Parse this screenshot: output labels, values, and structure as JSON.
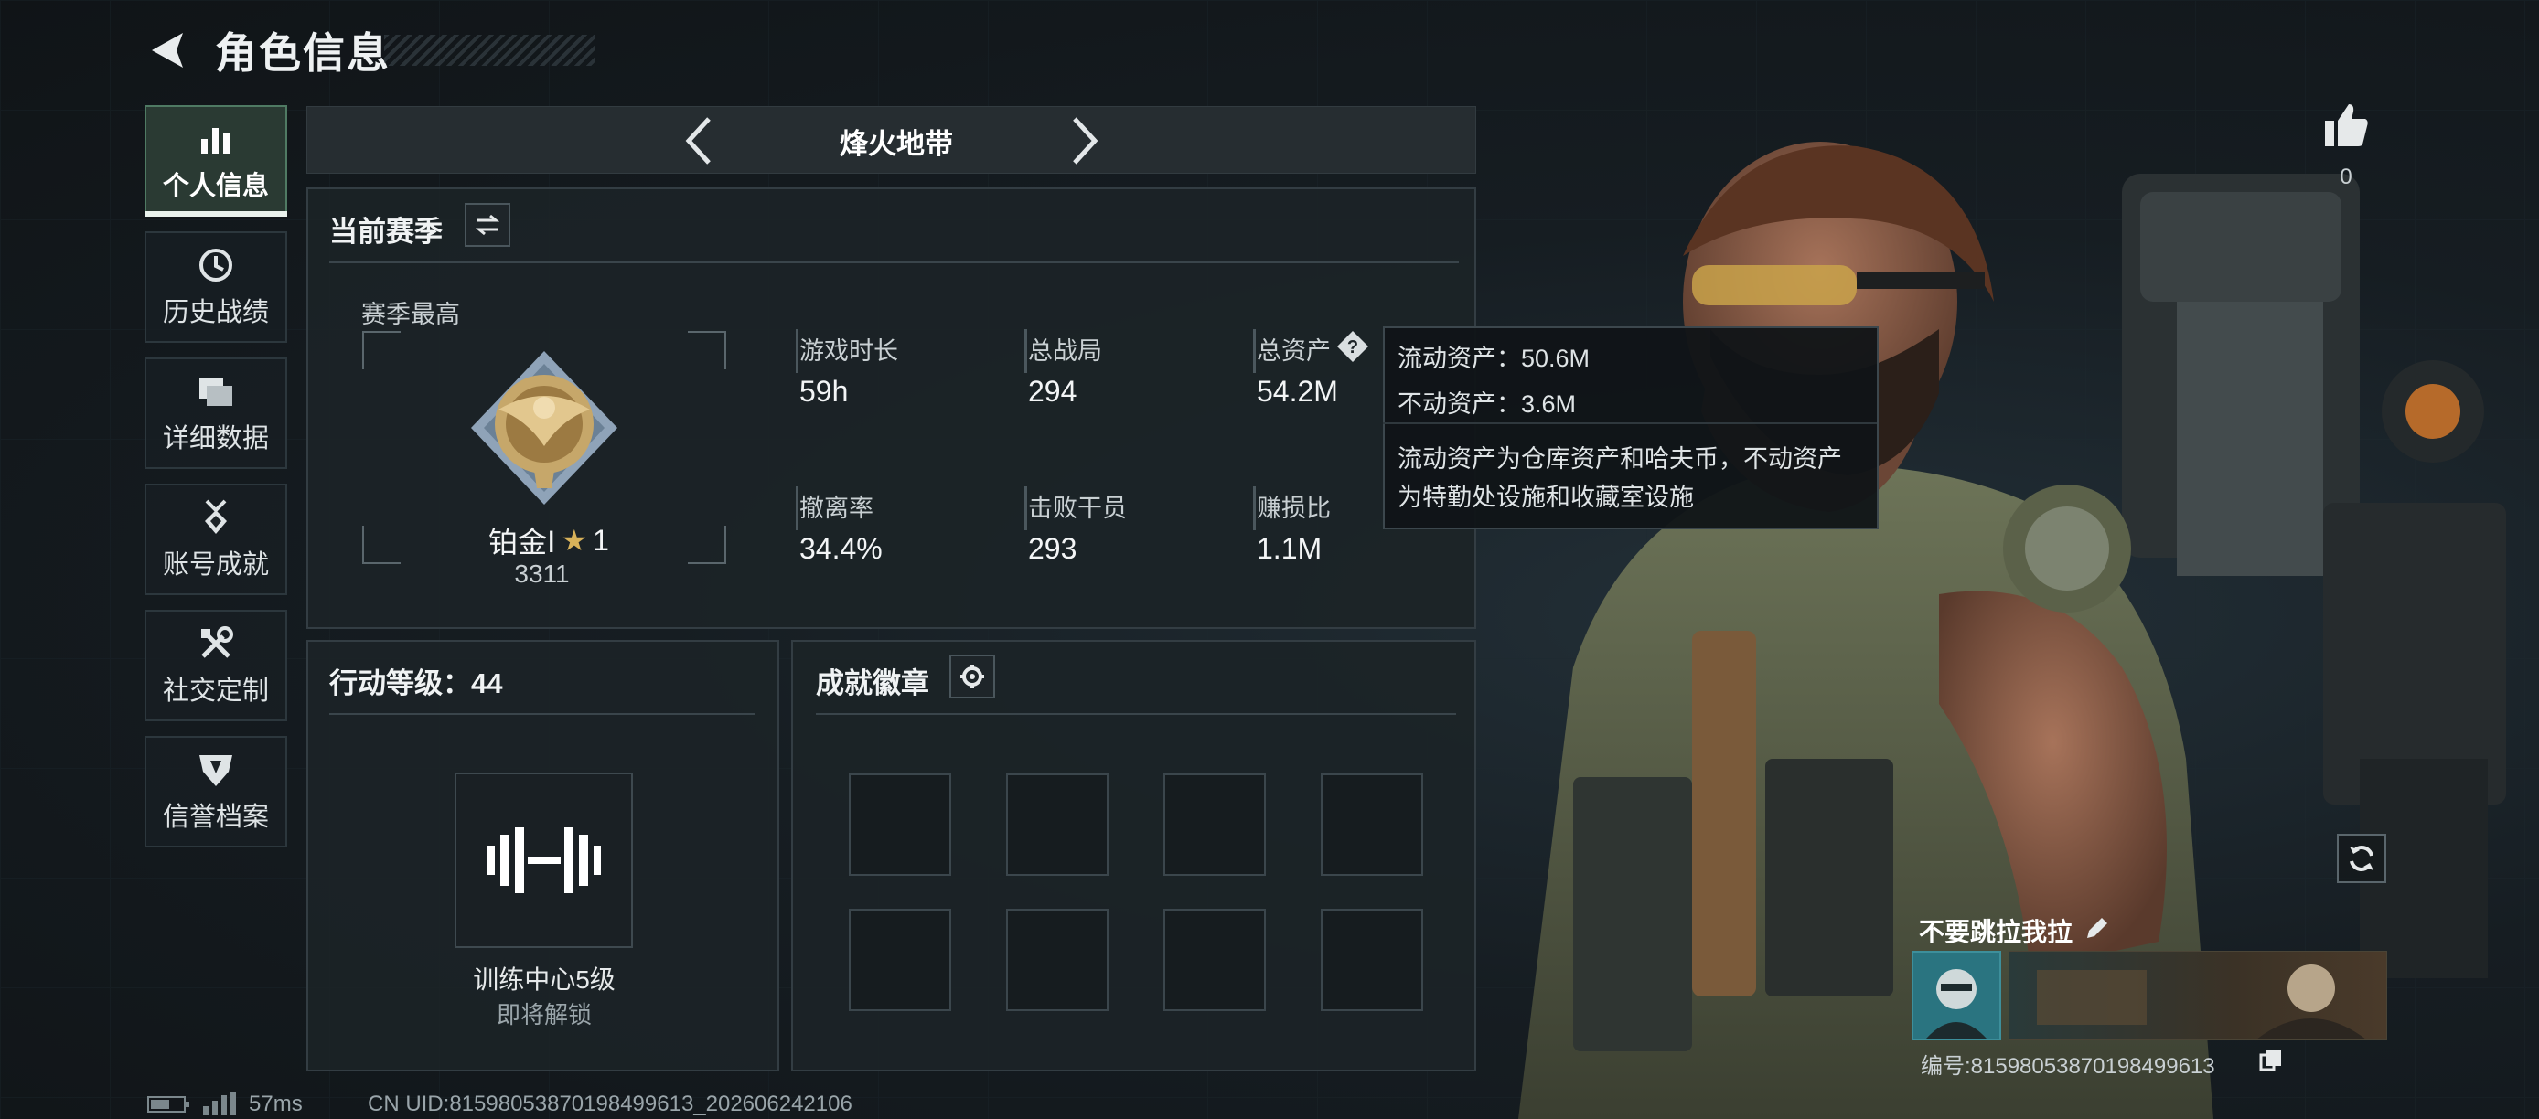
{
  "header": {
    "title": "角色信息"
  },
  "nav": {
    "items": [
      {
        "label": "个人信息",
        "active": true,
        "icon": "bar-chart-icon"
      },
      {
        "label": "历史战绩",
        "active": false,
        "icon": "history-clock-icon"
      },
      {
        "label": "详细数据",
        "active": false,
        "icon": "folder-icon"
      },
      {
        "label": "账号成就",
        "active": false,
        "icon": "medal-icon"
      },
      {
        "label": "社交定制",
        "active": false,
        "icon": "tools-icon"
      },
      {
        "label": "信誉档案",
        "active": false,
        "icon": "shield-badge-icon"
      }
    ]
  },
  "mode": {
    "label": "烽火地带"
  },
  "season": {
    "title": "当前赛季",
    "highest_label": "赛季最高",
    "rank_name": "铂金Ⅰ",
    "rank_stars": "1",
    "rank_score": "3311",
    "stats": [
      {
        "label": "游戏时长",
        "value": "59h"
      },
      {
        "label": "总战局",
        "value": "294"
      },
      {
        "label": "总资产",
        "value": "54.2M"
      },
      {
        "label": "撤离率",
        "value": "34.4%"
      },
      {
        "label": "击败干员",
        "value": "293"
      },
      {
        "label": "赚损比",
        "value": "1.1M"
      }
    ]
  },
  "tooltip": {
    "line1": "流动资产：50.6M",
    "line2": "不动资产：3.6M",
    "desc1": "流动资产为仓库资产和哈夫币，不动资产",
    "desc2": "为特勤处设施和收藏室设施"
  },
  "action_level": {
    "title": "行动等级：44",
    "card_label": "训练中心5级",
    "card_sub": "即将解锁"
  },
  "achievements": {
    "title": "成就徽章",
    "slots": 8
  },
  "profile": {
    "likes": "0",
    "name": "不要跳拉我拉",
    "id_text": "编号:81598053870198499613"
  },
  "footer": {
    "ping": "57ms",
    "uid": "CN UID:81598053870198499613_202606242106"
  },
  "colors": {
    "accent": "#4f7a63",
    "panel_bg": "#1c2327",
    "tooltip_bg": "#101417"
  }
}
